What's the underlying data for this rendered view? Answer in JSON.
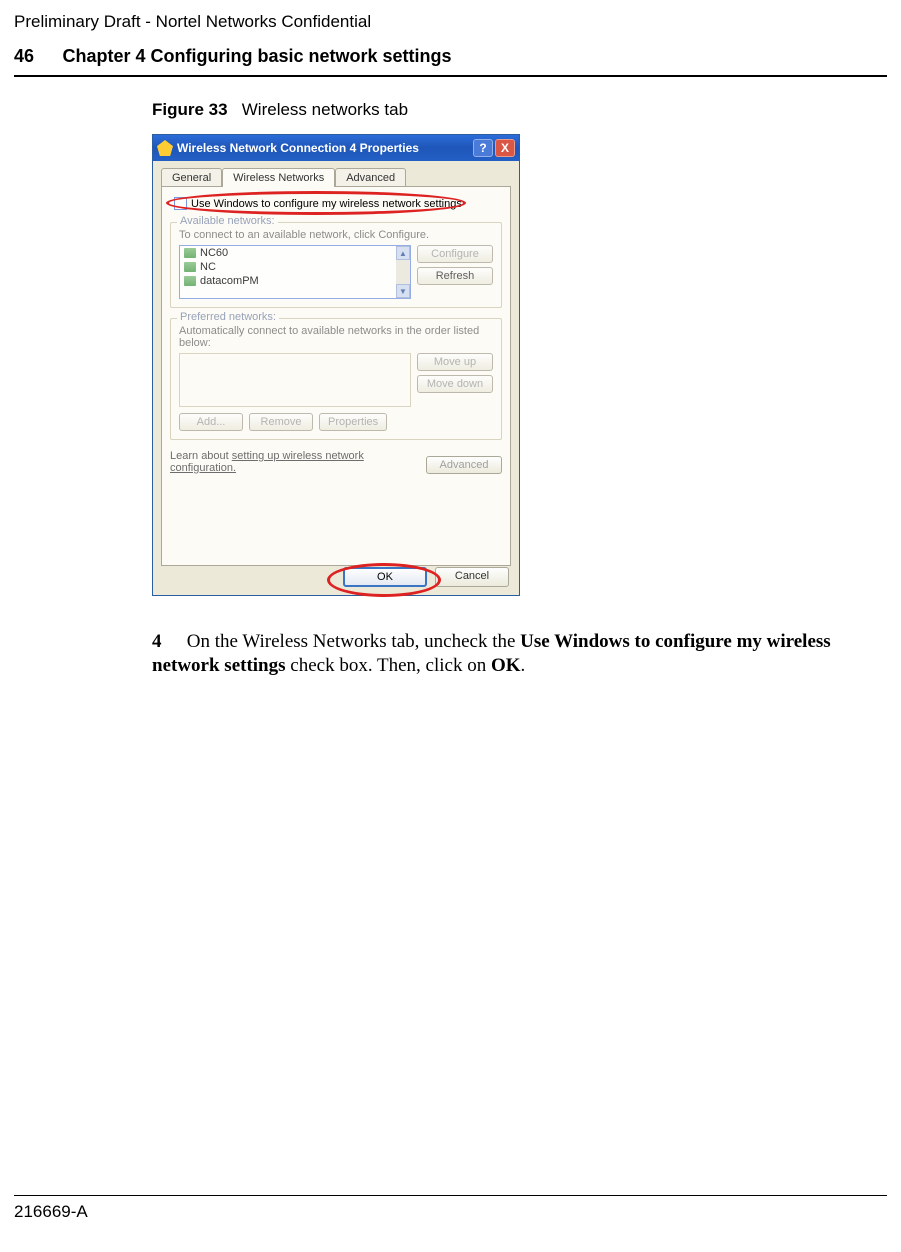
{
  "header": {
    "confidential": "Preliminary Draft - Nortel Networks Confidential",
    "page_number": "46",
    "chapter": "Chapter 4 Configuring basic network settings"
  },
  "figure": {
    "label_bold": "Figure 33",
    "label_rest": "Wireless networks tab"
  },
  "dialog": {
    "title": "Wireless Network Connection 4 Properties",
    "help_symbol": "?",
    "close_symbol": "X",
    "tabs": {
      "general": "General",
      "wireless": "Wireless Networks",
      "advanced": "Advanced"
    },
    "checkbox_label": "Use Windows to configure my wireless network settings",
    "available": {
      "legend": "Available networks:",
      "hint": "To connect to an available network, click Configure.",
      "items": [
        "NC60",
        "NC",
        "datacomPM"
      ],
      "scroll_up": "▲",
      "scroll_down": "▼",
      "configure": "Configure",
      "refresh": "Refresh"
    },
    "preferred": {
      "legend": "Preferred networks:",
      "hint": "Automatically connect to available networks in the order listed below:",
      "move_up": "Move up",
      "move_down": "Move down",
      "add": "Add...",
      "remove": "Remove",
      "properties": "Properties"
    },
    "learn": {
      "prefix": "Learn about ",
      "link": "setting up wireless network configuration.",
      "advanced": "Advanced"
    },
    "buttons": {
      "ok": "OK",
      "cancel": "Cancel"
    }
  },
  "instruction": {
    "step": "4",
    "part1": "On the Wireless Networks tab, uncheck the ",
    "bold1": "Use Windows to configure my wireless network settings",
    "part2": " check box. Then, click on ",
    "bold2": "OK",
    "part3": "."
  },
  "footer": {
    "doc_id": "216669-A"
  }
}
